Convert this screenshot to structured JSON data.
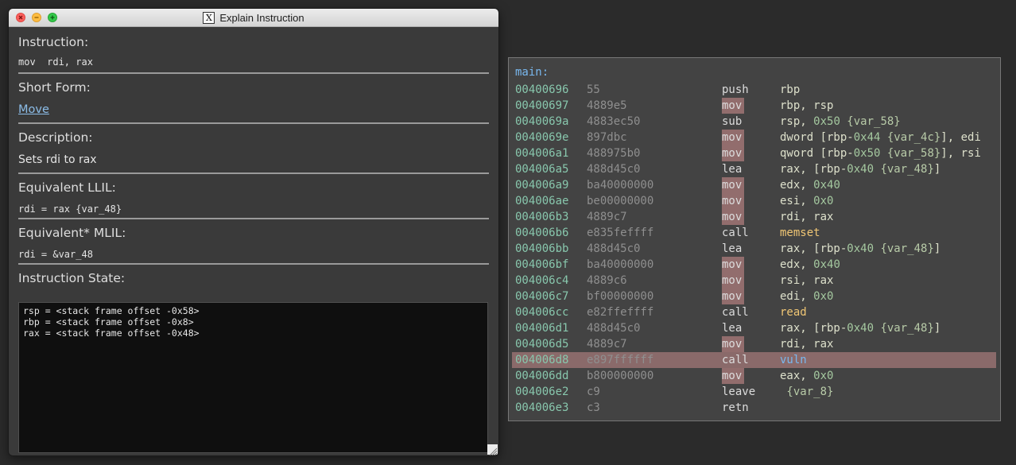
{
  "window": {
    "title": "Explain Instruction",
    "sections": {
      "instruction": {
        "label": "Instruction:",
        "value": "mov  rdi, rax"
      },
      "short_form": {
        "label": "Short Form:",
        "value": "Move"
      },
      "description": {
        "label": "Description:",
        "value": "Sets rdi to rax"
      },
      "llil": {
        "label": "Equivalent LLIL:",
        "value": "rdi = rax {var_48}"
      },
      "mlil": {
        "label": "Equivalent* MLIL:",
        "value": "rdi = &var_48"
      },
      "state": {
        "label": "Instruction State:",
        "lines": [
          "rsp = <stack frame offset -0x58>",
          "rbp = <stack frame offset -0x8>",
          "rax = <stack frame offset -0x48>"
        ]
      }
    }
  },
  "disassembly": {
    "function_label": "main:",
    "selected_index": 17,
    "rows": [
      {
        "addr": "00400696",
        "bytes": "55",
        "mnem": "push",
        "ops": [
          {
            "t": "rbp",
            "c": "reg"
          }
        ],
        "hl": false
      },
      {
        "addr": "00400697",
        "bytes": "4889e5",
        "mnem": "mov",
        "ops": [
          {
            "t": "rbp, rsp",
            "c": "reg"
          }
        ],
        "hl": true
      },
      {
        "addr": "0040069a",
        "bytes": "4883ec50",
        "mnem": "sub",
        "ops": [
          {
            "t": "rsp, ",
            "c": "reg"
          },
          {
            "t": "0x50",
            "c": "num"
          },
          {
            "t": " {var_58}",
            "c": "var"
          }
        ],
        "hl": false
      },
      {
        "addr": "0040069e",
        "bytes": "897dbc",
        "mnem": "mov",
        "ops": [
          {
            "t": "dword [rbp-",
            "c": "reg"
          },
          {
            "t": "0x44",
            "c": "num"
          },
          {
            "t": " {var_4c}",
            "c": "var"
          },
          {
            "t": "], edi",
            "c": "reg"
          }
        ],
        "hl": true
      },
      {
        "addr": "004006a1",
        "bytes": "488975b0",
        "mnem": "mov",
        "ops": [
          {
            "t": "qword [rbp-",
            "c": "reg"
          },
          {
            "t": "0x50",
            "c": "num"
          },
          {
            "t": " {var_58}",
            "c": "var"
          },
          {
            "t": "], rsi",
            "c": "reg"
          }
        ],
        "hl": true
      },
      {
        "addr": "004006a5",
        "bytes": "488d45c0",
        "mnem": "lea",
        "ops": [
          {
            "t": "rax, [rbp-",
            "c": "reg"
          },
          {
            "t": "0x40",
            "c": "num"
          },
          {
            "t": " {var_48}",
            "c": "var"
          },
          {
            "t": "]",
            "c": "reg"
          }
        ],
        "hl": false
      },
      {
        "addr": "004006a9",
        "bytes": "ba40000000",
        "mnem": "mov",
        "ops": [
          {
            "t": "edx, ",
            "c": "reg"
          },
          {
            "t": "0x40",
            "c": "num"
          }
        ],
        "hl": true
      },
      {
        "addr": "004006ae",
        "bytes": "be00000000",
        "mnem": "mov",
        "ops": [
          {
            "t": "esi, ",
            "c": "reg"
          },
          {
            "t": "0x0",
            "c": "num"
          }
        ],
        "hl": true
      },
      {
        "addr": "004006b3",
        "bytes": "4889c7",
        "mnem": "mov",
        "ops": [
          {
            "t": "rdi, rax",
            "c": "reg"
          }
        ],
        "hl": true
      },
      {
        "addr": "004006b6",
        "bytes": "e835feffff",
        "mnem": "call",
        "ops": [
          {
            "t": "memset",
            "c": "fname"
          }
        ],
        "hl": false
      },
      {
        "addr": "004006bb",
        "bytes": "488d45c0",
        "mnem": "lea",
        "ops": [
          {
            "t": "rax, [rbp-",
            "c": "reg"
          },
          {
            "t": "0x40",
            "c": "num"
          },
          {
            "t": " {var_48}",
            "c": "var"
          },
          {
            "t": "]",
            "c": "reg"
          }
        ],
        "hl": false
      },
      {
        "addr": "004006bf",
        "bytes": "ba40000000",
        "mnem": "mov",
        "ops": [
          {
            "t": "edx, ",
            "c": "reg"
          },
          {
            "t": "0x40",
            "c": "num"
          }
        ],
        "hl": true
      },
      {
        "addr": "004006c4",
        "bytes": "4889c6",
        "mnem": "mov",
        "ops": [
          {
            "t": "rsi, rax",
            "c": "reg"
          }
        ],
        "hl": true
      },
      {
        "addr": "004006c7",
        "bytes": "bf00000000",
        "mnem": "mov",
        "ops": [
          {
            "t": "edi, ",
            "c": "reg"
          },
          {
            "t": "0x0",
            "c": "num"
          }
        ],
        "hl": true
      },
      {
        "addr": "004006cc",
        "bytes": "e82ffeffff",
        "mnem": "call",
        "ops": [
          {
            "t": "read",
            "c": "fname"
          }
        ],
        "hl": false
      },
      {
        "addr": "004006d1",
        "bytes": "488d45c0",
        "mnem": "lea",
        "ops": [
          {
            "t": "rax, [rbp-",
            "c": "reg"
          },
          {
            "t": "0x40",
            "c": "num"
          },
          {
            "t": " {var_48}",
            "c": "var"
          },
          {
            "t": "]",
            "c": "reg"
          }
        ],
        "hl": false
      },
      {
        "addr": "004006d5",
        "bytes": "4889c7",
        "mnem": "mov",
        "ops": [
          {
            "t": "rdi, rax",
            "c": "reg"
          }
        ],
        "hl": true
      },
      {
        "addr": "004006d8",
        "bytes": "e897ffffff",
        "mnem": "call",
        "ops": [
          {
            "t": "vuln",
            "c": "callname"
          }
        ],
        "hl": false
      },
      {
        "addr": "004006dd",
        "bytes": "b800000000",
        "mnem": "mov",
        "ops": [
          {
            "t": "eax, ",
            "c": "reg"
          },
          {
            "t": "0x0",
            "c": "num"
          }
        ],
        "hl": true
      },
      {
        "addr": "004006e2",
        "bytes": "c9",
        "mnem": "leave",
        "ops": [
          {
            "t": " {var_8}",
            "c": "var"
          }
        ],
        "hl": false
      },
      {
        "addr": "004006e3",
        "bytes": "c3",
        "mnem": "retn",
        "ops": [],
        "hl": false
      }
    ]
  }
}
